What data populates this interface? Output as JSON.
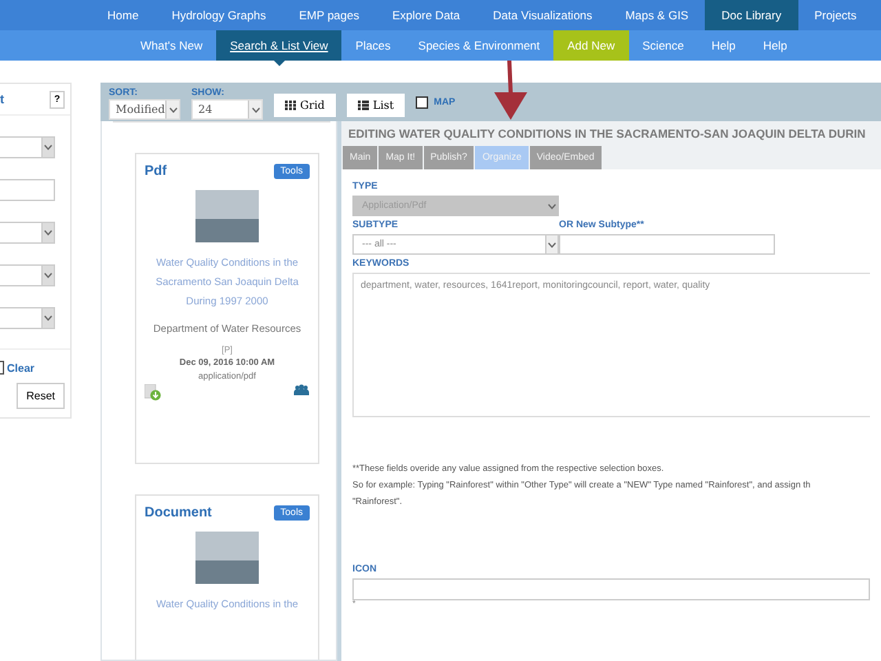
{
  "top_nav": {
    "items": [
      {
        "label": "Home",
        "selected": false
      },
      {
        "label": "Hydrology Graphs",
        "selected": false
      },
      {
        "label": "EMP pages",
        "selected": false
      },
      {
        "label": "Explore Data",
        "selected": false
      },
      {
        "label": "Data Visualizations",
        "selected": false
      },
      {
        "label": "Maps & GIS",
        "selected": false
      },
      {
        "label": "Doc Library",
        "selected": true
      },
      {
        "label": "Projects",
        "selected": false
      }
    ]
  },
  "sub_nav": {
    "items": [
      {
        "label": "What's New",
        "selected": false,
        "highlighted": false
      },
      {
        "label": "Search & List View",
        "selected": true,
        "highlighted": false
      },
      {
        "label": "Places",
        "selected": false,
        "highlighted": false
      },
      {
        "label": "Species & Environment",
        "selected": false,
        "highlighted": false
      },
      {
        "label": "Add New",
        "selected": false,
        "highlighted": true
      },
      {
        "label": "Science",
        "selected": false,
        "highlighted": false
      },
      {
        "label": "Help",
        "selected": false,
        "highlighted": false
      },
      {
        "label": "Help",
        "selected": false,
        "highlighted": false
      }
    ]
  },
  "filter_panel": {
    "title": "t",
    "help_button": "?",
    "fields": [
      {
        "kind": "select"
      },
      {
        "kind": "input"
      },
      {
        "kind": "select"
      },
      {
        "kind": "select"
      },
      {
        "kind": "select"
      }
    ],
    "clear_link": "Clear",
    "reset_button": "Reset"
  },
  "toolbar": {
    "sort": {
      "label": "SORT:",
      "value": "Modified"
    },
    "show": {
      "label": "SHOW:",
      "value": "24"
    },
    "views": [
      {
        "kind": "grid",
        "label": "Grid"
      },
      {
        "kind": "list",
        "label": "List"
      }
    ],
    "map": {
      "label": "MAP",
      "checked": false
    }
  },
  "results": [
    {
      "type": "Pdf",
      "tools_button": "Tools",
      "title": "Water Quality Conditions in the Sacramento San Joaquin Delta During 1997 2000",
      "author": "Department of Water Resources",
      "flag": "[P]",
      "date": "Dec 09, 2016 10:00 AM",
      "mime": "application/pdf"
    },
    {
      "type": "Document",
      "tools_button": "Tools",
      "title": "Water Quality Conditions in the"
    }
  ],
  "editor": {
    "title": "EDITING WATER QUALITY CONDITIONS IN THE SACRAMENTO-SAN JOAQUIN DELTA DURIN",
    "tabs": [
      {
        "label": "Main",
        "selected": false
      },
      {
        "label": "Map It!",
        "selected": false
      },
      {
        "label": "Publish?",
        "selected": false
      },
      {
        "label": "Organize",
        "selected": true
      },
      {
        "label": "Video/Embed",
        "selected": false
      }
    ],
    "type": {
      "label": "TYPE",
      "value": "Application/Pdf",
      "disabled": true
    },
    "subtype": {
      "label": "SUBTYPE",
      "value": "--- all ---"
    },
    "new_subtype": {
      "label": "OR New Subtype**"
    },
    "keywords": {
      "label": "KEYWORDS",
      "value": "department, water, resources, 1641report, monitoringcouncil, report, water, quality"
    },
    "notes": [
      "**These fields overide any value assigned from the respective selection boxes.",
      "So for example: Typing \"Rainforest\" within \"Other Type\" will create a \"NEW\" Type named \"Rainforest\", and assign th",
      "\"Rainforest\"."
    ],
    "icon": {
      "label": "ICON",
      "note": "*"
    }
  }
}
